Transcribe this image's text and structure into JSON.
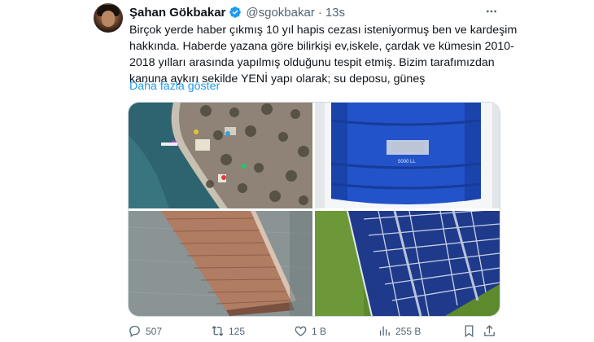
{
  "tweet": {
    "author_name": "Şahan Gökbakar",
    "handle": "@sgokbakar",
    "separator": "·",
    "time": "13s",
    "text_lines": [
      "Birçok yerde haber çıkmış 10 yıl hapis cezası isteniyormuş ben ve kardeşim",
      "hakkında. Haberde yazana göre bilirkişi ev,iskele, çardak ve kümesin 2010-",
      "2018 yılları arasında yapılmış olduğunu tespit etmiş. Bizim tarafımızdan",
      "kanuna aykırı sekilde YENİ yapı olarak; su deposu, güneş"
    ],
    "show_more": "Daha fazla göster",
    "water_tank_label": "5000 LL"
  },
  "media": {
    "images": [
      {
        "name": "aerial-photo",
        "depicts": "aerial view of shoreline property"
      },
      {
        "name": "water-tank-photo",
        "depicts": "blue water tank"
      },
      {
        "name": "pier-photo",
        "depicts": "wooden pier on water"
      },
      {
        "name": "solar-panel-photo",
        "depicts": "solar panels on grass"
      }
    ]
  },
  "actions": {
    "replies": "507",
    "retweets": "125",
    "likes": "1 B",
    "views": "255 B"
  },
  "icons": [
    "verified-badge-icon",
    "more-options-icon",
    "reply-icon",
    "retweet-icon",
    "like-icon",
    "views-icon",
    "bookmark-icon",
    "share-icon"
  ],
  "colors": {
    "accent": "#1d9bf0",
    "muted": "#536471",
    "text": "#0f1419",
    "tank_blue": "#2353c9"
  }
}
